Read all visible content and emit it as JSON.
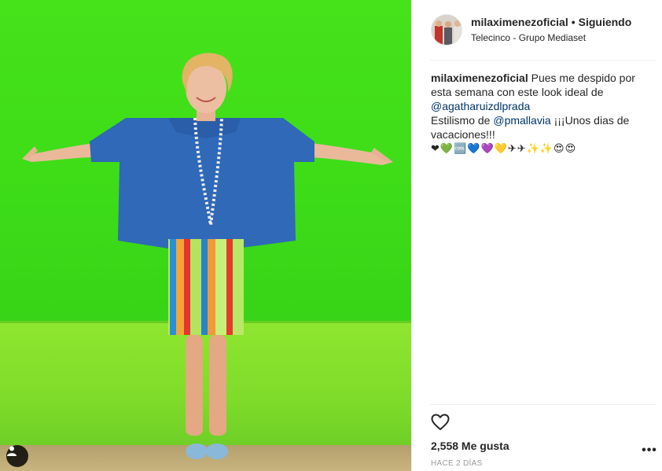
{
  "post": {
    "username": "milaximenezoficial",
    "separator": "•",
    "follow_status": "Siguiendo",
    "location": "Telecinco - Grupo Mediaset",
    "caption": {
      "username": "milaximenezoficial",
      "text_1": " Pues me despido por esta semana con este look ideal de ",
      "mention_1": "@agatharuizdlprada",
      "text_2": "Estilismo de ",
      "mention_2": "@pmallavia",
      "text_3": " ¡¡¡Unos dias de vacaciones!!!",
      "emojis": [
        "❤",
        "💚",
        "🆒",
        "💙",
        "💜",
        "💛",
        "✈",
        "✈",
        "✨",
        "✨",
        "😍",
        "😍"
      ]
    },
    "likes": "2,558 Me gusta",
    "timestamp": "HACE 2 DÍAS",
    "more_label": "•••"
  },
  "icons": {
    "user_tag": "user-tag-icon",
    "like": "heart-outline-icon",
    "more": "more-options-icon"
  },
  "colors": {
    "backdrop_green": "#46e21a",
    "wall_lime": "#8ee62f",
    "top_blue": "#2f69b8",
    "mention_blue": "#003569",
    "text_dark": "#262626",
    "muted_gray": "#999999"
  }
}
